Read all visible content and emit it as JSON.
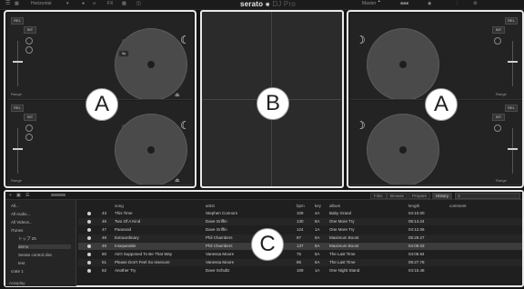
{
  "app": {
    "logo_brand": "serato",
    "logo_product": "DJ Pro",
    "layout_label": "Horizontal",
    "master_label": "Master",
    "icons": [
      "menu-icon",
      "record-icon",
      "fx-icon",
      "sampler-icon",
      "midi-icon"
    ]
  },
  "decks": [
    {
      "label_rel": "REL",
      "label_int": "INT",
      "sync": "SYNC",
      "range": "Range"
    },
    {
      "label_rel": "REL",
      "label_int": "INT",
      "sync": "SYNC",
      "range": "Range"
    },
    {
      "label_rel": "REL",
      "label_int": "INT",
      "sync": "SYNC",
      "range": "Range"
    },
    {
      "label_rel": "REL",
      "label_int": "INT",
      "sync": "SYNC",
      "range": "Range"
    }
  ],
  "callouts": {
    "left": "A",
    "center": "B",
    "right": "A",
    "library": "C"
  },
  "library": {
    "tabs": [
      "Files",
      "Browse",
      "Prepare",
      "History"
    ],
    "crates": [
      "All...",
      "All Audio...",
      "All Videos...",
      "iTunes",
      "トップ 25",
      "demo",
      "Serato control disc",
      "test",
      "crate 1"
    ],
    "columns": {
      "song": "song",
      "artist": "artist",
      "bpm": "bpm",
      "key": "key",
      "album": "album",
      "length": "length",
      "comment": "comment"
    },
    "tracks": [
      {
        "num": "43",
        "song": "This Time",
        "artist": "Stephen Connors",
        "bpm": "109",
        "key": "4A",
        "album": "Baby Grand",
        "length": "04:10.00"
      },
      {
        "num": "45",
        "song": "Two Of A Kind",
        "artist": "Dave Griffin",
        "bpm": "130",
        "key": "8A",
        "album": "One More Try",
        "length": "05:14.24"
      },
      {
        "num": "47",
        "song": "Paranoid",
        "artist": "Dave Griffin",
        "bpm": "124",
        "key": "1A",
        "album": "One More Try",
        "length": "04:12.06"
      },
      {
        "num": "48",
        "song": "Extraordinary",
        "artist": "Phil Chambers",
        "bpm": "87",
        "key": "5A",
        "album": "Maximum Boost",
        "length": "05:29.27"
      },
      {
        "num": "49",
        "song": "Inseparable",
        "artist": "Phil Chambers",
        "bpm": "137",
        "key": "8A",
        "album": "Maximum Boost",
        "length": "04:08.03"
      },
      {
        "num": "50",
        "song": "Ain't Supposed To Be That Way",
        "artist": "Vanessa Moore",
        "bpm": "75",
        "key": "5A",
        "album": "The Last Time",
        "length": "04:06.94"
      },
      {
        "num": "51",
        "song": "Please Don't Feel So Insecure",
        "artist": "Vanessa Moore",
        "bpm": "86",
        "key": "6A",
        "album": "The Last Time",
        "length": "06:27.78"
      },
      {
        "num": "52",
        "song": "Another Try",
        "artist": "Dave Schultz",
        "bpm": "109",
        "key": "1A",
        "album": "One Night Stand",
        "length": "04:15.48"
      }
    ],
    "autoplay": "Autoplay"
  }
}
